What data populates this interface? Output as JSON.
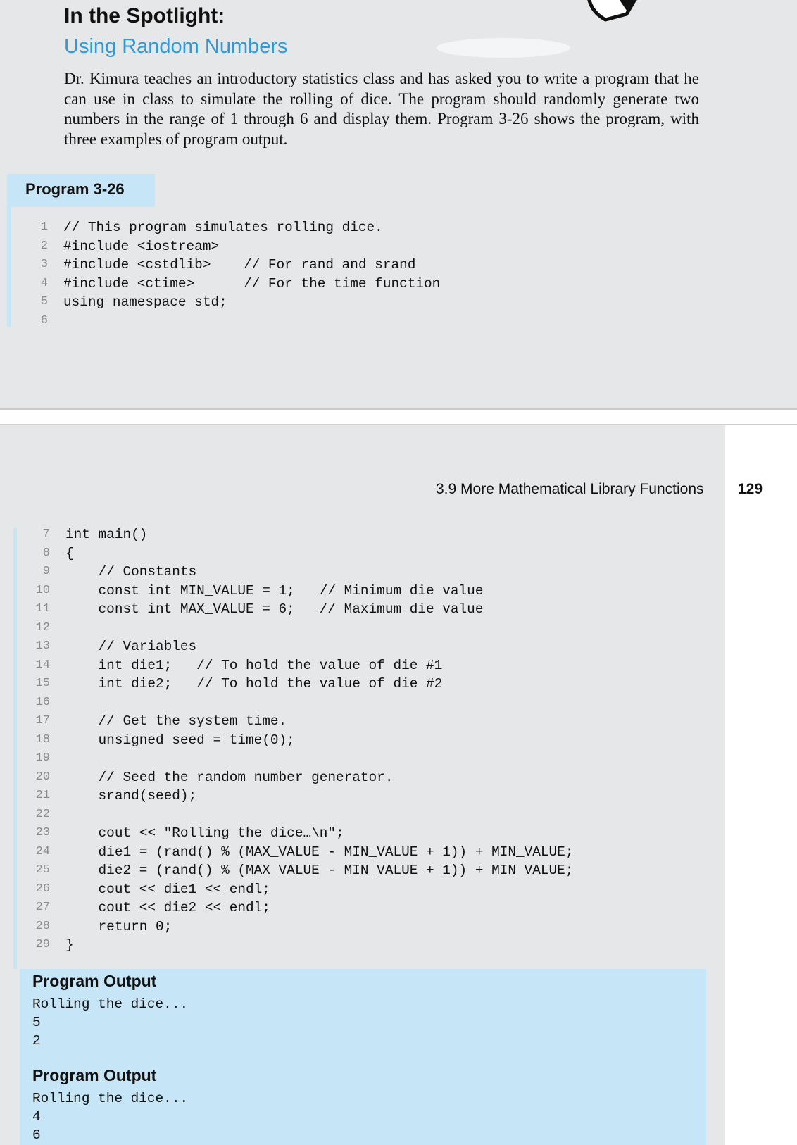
{
  "spotlight": {
    "title": "In the Spotlight:",
    "subtitle": "Using Random Numbers",
    "intro": "Dr. Kimura teaches an introductory statistics class and has asked you to write a program that he can use in class to simulate the rolling of dice. The program should randomly gener­ate two numbers in the range of 1 through 6 and display them. Program 3-26 shows the program, with three examples of program output."
  },
  "program_label": "Program 3-26",
  "code_part1": [
    {
      "n": "1",
      "text": "// This program simulates rolling dice."
    },
    {
      "n": "2",
      "text": "#include <iostream>"
    },
    {
      "n": "3",
      "text": "#include <cstdlib>    // For rand and srand"
    },
    {
      "n": "4",
      "text": "#include <ctime>      // For the time function"
    },
    {
      "n": "5",
      "text": "using namespace std;"
    },
    {
      "n": "6",
      "text": ""
    }
  ],
  "running_header": {
    "section": "3.9 More Mathematical Library Functions",
    "page": "129"
  },
  "code_part2": [
    {
      "n": "7",
      "text": "int main()"
    },
    {
      "n": "8",
      "text": "{"
    },
    {
      "n": "9",
      "text": "    // Constants"
    },
    {
      "n": "10",
      "text": "    const int MIN_VALUE = 1;   // Minimum die value"
    },
    {
      "n": "11",
      "text": "    const int MAX_VALUE = 6;   // Maximum die value"
    },
    {
      "n": "12",
      "text": ""
    },
    {
      "n": "13",
      "text": "    // Variables"
    },
    {
      "n": "14",
      "text": "    int die1;   // To hold the value of die #1"
    },
    {
      "n": "15",
      "text": "    int die2;   // To hold the value of die #2"
    },
    {
      "n": "16",
      "text": ""
    },
    {
      "n": "17",
      "text": "    // Get the system time."
    },
    {
      "n": "18",
      "text": "    unsigned seed = time(0);"
    },
    {
      "n": "19",
      "text": ""
    },
    {
      "n": "20",
      "text": "    // Seed the random number generator."
    },
    {
      "n": "21",
      "text": "    srand(seed);"
    },
    {
      "n": "22",
      "text": ""
    },
    {
      "n": "23",
      "text": "    cout << \"Rolling the dice…\\n\";"
    },
    {
      "n": "24",
      "text": "    die1 = (rand() % (MAX_VALUE - MIN_VALUE + 1)) + MIN_VALUE;"
    },
    {
      "n": "25",
      "text": "    die2 = (rand() % (MAX_VALUE - MIN_VALUE + 1)) + MIN_VALUE;"
    },
    {
      "n": "26",
      "text": "    cout << die1 << endl;"
    },
    {
      "n": "27",
      "text": "    cout << die2 << endl;"
    },
    {
      "n": "28",
      "text": "    return 0;"
    },
    {
      "n": "29",
      "text": "}"
    }
  ],
  "outputs": [
    {
      "heading": "Program Output",
      "lines": [
        "Rolling the dice...",
        "5",
        "2"
      ]
    },
    {
      "heading": "Program Output",
      "lines": [
        "Rolling the dice...",
        "4",
        "6"
      ]
    }
  ]
}
